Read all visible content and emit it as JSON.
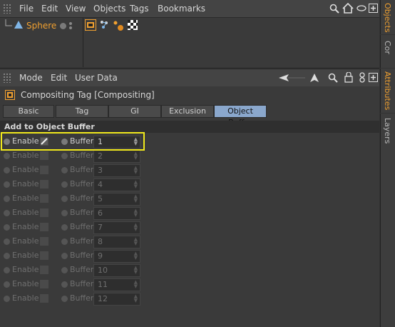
{
  "objects_manager": {
    "menu": [
      "File",
      "Edit",
      "View",
      "Objects",
      "Tags",
      "Bookmarks"
    ],
    "object_name": "Sphere",
    "side_tabs": [
      "Objects",
      "Cor"
    ]
  },
  "attributes_manager": {
    "menu": [
      "Mode",
      "Edit",
      "User Data"
    ],
    "title": "Compositing Tag [Compositing]",
    "tabs": [
      "Basic",
      "Tag",
      "GI",
      "Exclusion",
      "Object Buffer"
    ],
    "active_tab": "Object Buffer",
    "section": "Add to Object Buffer",
    "enable_label": "Enable",
    "buffer_label": "Buffer",
    "rows": [
      {
        "buffer": "1",
        "enabled": true
      },
      {
        "buffer": "2",
        "enabled": false
      },
      {
        "buffer": "3",
        "enabled": false
      },
      {
        "buffer": "4",
        "enabled": false
      },
      {
        "buffer": "5",
        "enabled": false
      },
      {
        "buffer": "6",
        "enabled": false
      },
      {
        "buffer": "7",
        "enabled": false
      },
      {
        "buffer": "8",
        "enabled": false
      },
      {
        "buffer": "9",
        "enabled": false
      },
      {
        "buffer": "10",
        "enabled": false
      },
      {
        "buffer": "11",
        "enabled": false
      },
      {
        "buffer": "12",
        "enabled": false
      }
    ],
    "side_tabs": [
      "Attributes",
      "Layers"
    ]
  },
  "colors": {
    "accent_orange": "#f0a030",
    "active_tab": "#8aa7cc",
    "highlight": "#f0e81c"
  }
}
